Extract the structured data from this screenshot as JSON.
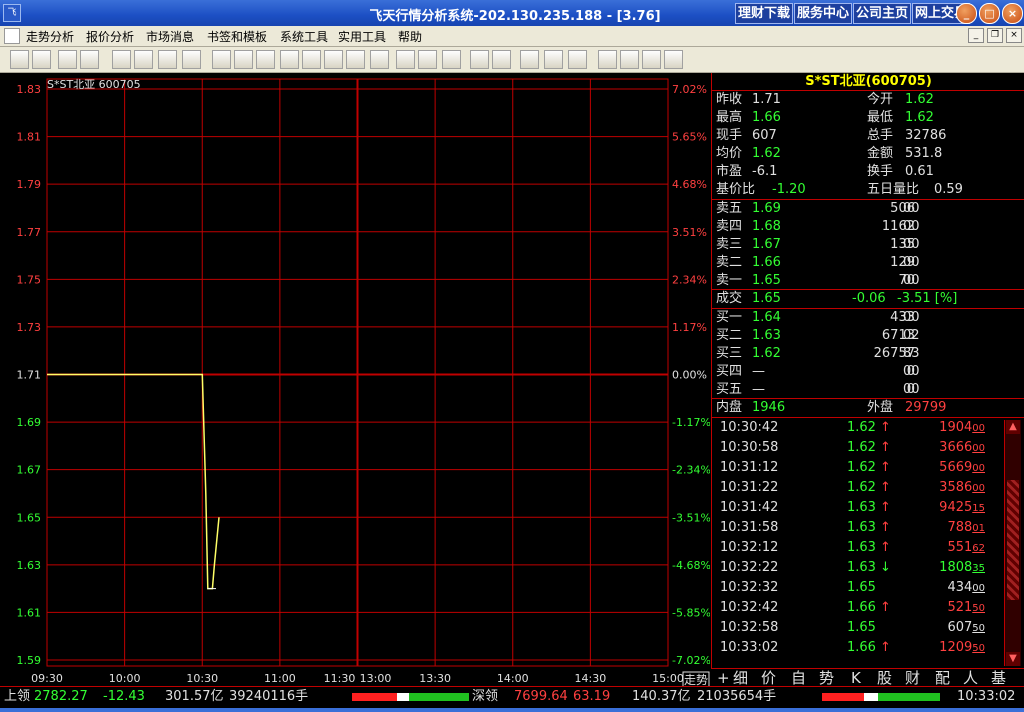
{
  "window": {
    "title": "飞天行情分析系统-202.130.235.188 - [3.76]",
    "app_icon_text": "飞",
    "links": [
      "理财下载",
      "服务中心",
      "公司主页",
      "网上交易"
    ]
  },
  "menu": {
    "items": [
      "走势分析",
      "报价分析",
      "市场消息",
      "书签和模板",
      "系统工具",
      "实用工具",
      "帮助"
    ]
  },
  "toolbar": {
    "icons": [
      "back-icon",
      "list-icon",
      "sh-index-icon",
      "sz-index-icon",
      "chart-a-icon",
      "ash-icon",
      "asz-icon",
      "pen-icon",
      "trend-icon",
      "kline-day-icon",
      "kline-week-icon",
      "kline-month-icon",
      "min5-icon",
      "min15-icon",
      "min30-icon",
      "min60-icon",
      "arrow-icon",
      "compare-icon",
      "bar-icon",
      "grid-icon",
      "a-icon",
      "ball1-icon",
      "ball2-icon",
      "ball3-icon",
      "doc1-icon",
      "doc2-icon",
      "doc3-icon",
      "doc4-icon"
    ]
  },
  "chart": {
    "stock_label": "S*ST北亚 600705",
    "y_price_labels": [
      "1.83",
      "1.81",
      "1.79",
      "1.77",
      "1.75",
      "1.73",
      "1.71",
      "1.69",
      "1.67",
      "1.65",
      "1.63",
      "1.61",
      "1.59"
    ],
    "y_pct_labels": [
      "7.02%",
      "5.65%",
      "4.68%",
      "3.51%",
      "2.34%",
      "1.17%",
      "0.00%",
      "-1.17%",
      "-2.34%",
      "-3.51%",
      "-4.68%",
      "-5.85%",
      "-7.02%"
    ],
    "x_labels": [
      "09:30",
      "10:00",
      "10:30",
      "11:00",
      "11:30",
      "13:00",
      "13:30",
      "14:00",
      "14:30",
      "15:00"
    ],
    "corner_tab": "走势",
    "colors": {
      "grid": "#c00000",
      "price_line": "#ffff66",
      "avg_line": "#ffffff",
      "up": "#ff4040",
      "down": "#33ff33",
      "prev_close": "#c00000"
    }
  },
  "chart_data": {
    "type": "line",
    "title": "S*ST北亚 600705",
    "xlabel": "",
    "ylabel": "",
    "ylim": [
      1.59,
      1.83
    ],
    "x_range": [
      "09:30",
      "15:00"
    ],
    "prev_close": 1.71,
    "series": [
      {
        "values": [
          {
            "t": "09:30",
            "v": 1.71
          },
          {
            "t": "10:30",
            "v": 1.71
          },
          {
            "t": "10:31",
            "v": 1.66
          },
          {
            "t": "10:31",
            "v": 1.62
          },
          {
            "t": "10:32",
            "v": 1.62
          },
          {
            "t": "10:32",
            "v": 1.63
          },
          {
            "t": "10:33",
            "v": 1.65
          }
        ]
      },
      {
        "values": [
          {
            "t": "10:32",
            "v": 1.62
          },
          {
            "t": "10:33",
            "v": 1.62
          }
        ]
      }
    ]
  },
  "panel": {
    "title": "S*ST北亚(600705)",
    "quote": [
      {
        "l1": "昨收",
        "v1": "1.71",
        "c1": "v-white",
        "l2": "今开",
        "v2": "1.62",
        "c2": "v-green"
      },
      {
        "l1": "最高",
        "v1": "1.66",
        "c1": "v-green",
        "l2": "最低",
        "v2": "1.62",
        "c2": "v-green"
      },
      {
        "l1": "现手",
        "v1": "607",
        "c1": "v-white",
        "l2": "总手",
        "v2": "32786",
        "c2": "v-white"
      },
      {
        "l1": "均价",
        "v1": "1.62",
        "c1": "v-green",
        "l2": "金额",
        "v2": "531.8",
        "c2": "v-white"
      },
      {
        "l1": "市盈",
        "v1": "-6.1",
        "c1": "v-white",
        "l2": "换手",
        "v2": "0.61",
        "c2": "v-white"
      },
      {
        "l1": "基价比",
        "v1": "-1.20",
        "c1": "v-green",
        "l2": "五日量比",
        "v2": "0.59",
        "c2": "v-white"
      }
    ],
    "asks": [
      {
        "l": "卖五",
        "p": "1.69",
        "vol": "506",
        "sub": "00"
      },
      {
        "l": "卖四",
        "p": "1.68",
        "vol": "1162",
        "sub": "00"
      },
      {
        "l": "卖三",
        "p": "1.67",
        "vol": "135",
        "sub": "00"
      },
      {
        "l": "卖二",
        "p": "1.66",
        "vol": "129",
        "sub": "00"
      },
      {
        "l": "卖一",
        "p": "1.65",
        "vol": "70",
        "sub": "00"
      }
    ],
    "deal": {
      "l": "成交",
      "p": "1.65",
      "chg": "-0.06",
      "pct": "-3.51 [%]"
    },
    "bids": [
      {
        "l": "买一",
        "p": "1.64",
        "vol": "433",
        "sub": "00"
      },
      {
        "l": "买二",
        "p": "1.63",
        "vol": "6713",
        "sub": "02"
      },
      {
        "l": "买三",
        "p": "1.62",
        "vol": "26757",
        "sub": "83"
      },
      {
        "l": "买四",
        "p": "—",
        "vol": "0",
        "sub": "00"
      },
      {
        "l": "买五",
        "p": "—",
        "vol": "0",
        "sub": "00"
      }
    ],
    "inner_label": "内盘",
    "inner": "1946",
    "outer_label": "外盘",
    "outer": "29799",
    "ticks": [
      {
        "t": "10:30:42",
        "p": "1.62",
        "d": "up",
        "v": "1904",
        "s": "00",
        "vc": "v-red"
      },
      {
        "t": "10:30:58",
        "p": "1.62",
        "d": "up",
        "v": "3666",
        "s": "00",
        "vc": "v-red"
      },
      {
        "t": "10:31:12",
        "p": "1.62",
        "d": "up",
        "v": "5669",
        "s": "00",
        "vc": "v-red"
      },
      {
        "t": "10:31:22",
        "p": "1.62",
        "d": "up",
        "v": "3586",
        "s": "00",
        "vc": "v-red"
      },
      {
        "t": "10:31:42",
        "p": "1.63",
        "d": "up",
        "v": "9425",
        "s": "15",
        "vc": "v-red"
      },
      {
        "t": "10:31:58",
        "p": "1.63",
        "d": "up",
        "v": "788",
        "s": "01",
        "vc": "v-red"
      },
      {
        "t": "10:32:12",
        "p": "1.63",
        "d": "up",
        "v": "551",
        "s": "62",
        "vc": "v-red"
      },
      {
        "t": "10:32:22",
        "p": "1.63",
        "d": "down",
        "v": "1808",
        "s": "35",
        "vc": "v-green"
      },
      {
        "t": "10:32:32",
        "p": "1.65",
        "d": "",
        "v": "434",
        "s": "00",
        "vc": "v-white"
      },
      {
        "t": "10:32:42",
        "p": "1.66",
        "d": "up",
        "v": "521",
        "s": "50",
        "vc": "v-red"
      },
      {
        "t": "10:32:58",
        "p": "1.65",
        "d": "",
        "v": "607",
        "s": "50",
        "vc": "v-white"
      },
      {
        "t": "10:33:02",
        "p": "1.66",
        "d": "up",
        "v": "1209",
        "s": "50",
        "vc": "v-red"
      }
    ],
    "tabs": [
      "+",
      "细",
      "价",
      "自",
      "势",
      "K",
      "股",
      "财",
      "配",
      "人",
      "基"
    ]
  },
  "status": {
    "sh_label": "上领",
    "sh_val": "2782.27",
    "sh_chg": "-12.43",
    "sh_amt": "301.57亿",
    "sh_vol": "39240116手",
    "sz_label": "深领",
    "sz_val": "7699.64",
    "sz_chg": "63.19",
    "sz_amt": "140.37亿",
    "sz_vol": "21035654手",
    "time": "10:33:02"
  }
}
